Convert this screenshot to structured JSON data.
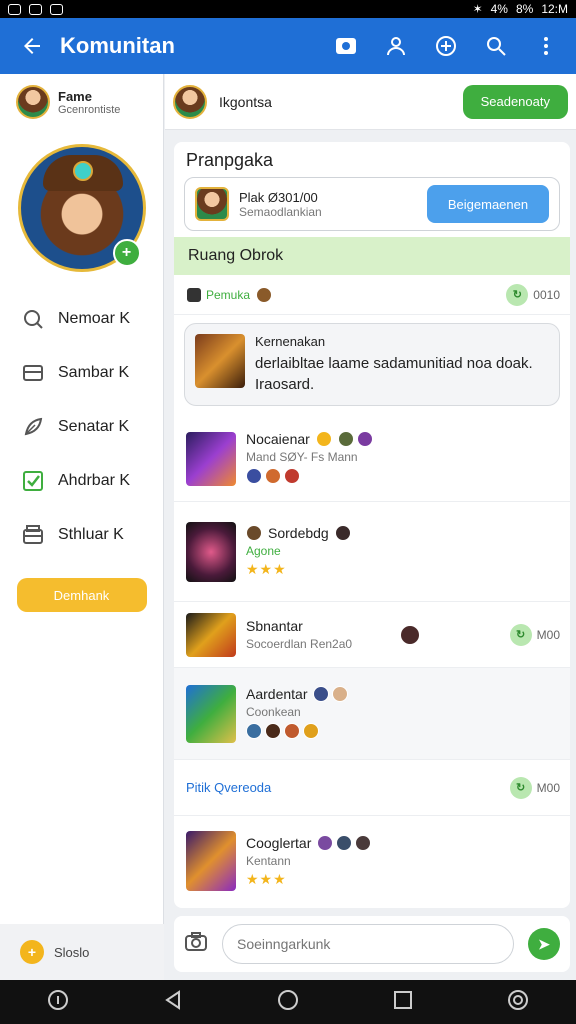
{
  "status_bar": {
    "battery": "8%",
    "time": "12:M",
    "signal": "4%",
    "left_icons": [
      "v-icon",
      "clock-icon",
      "cloud-icon"
    ]
  },
  "app_bar": {
    "title": "Komunitan",
    "color": "#1f6fd6",
    "actions": [
      "camera-icon",
      "person-icon",
      "add-icon",
      "search-icon",
      "more-icon"
    ]
  },
  "sidebar": {
    "profile_name": "Fame",
    "profile_sub": "Gcenrontiste",
    "menu": [
      {
        "label": "Nemoar K",
        "icon": "search-icon"
      },
      {
        "label": "Sambar K",
        "icon": "inbox-icon"
      },
      {
        "label": "Senatar K",
        "icon": "feather-icon"
      },
      {
        "label": "Ahdrbar K",
        "icon": "checkbox-icon"
      },
      {
        "label": "Sthluar K",
        "icon": "archive-icon"
      }
    ],
    "button_label": "Demhank",
    "footer_label": "Sloslo"
  },
  "topbar": {
    "name": "Ikgontsa",
    "button_label": "Seadenoaty"
  },
  "card": {
    "title": "Pranpgaka",
    "invite": {
      "line1": "Plak Ø301/00",
      "line2": "Semaodlankian",
      "button": "Beigemaenen"
    },
    "chat_header": "Ruang Obrok",
    "section_label": "Pemuka",
    "section_count": "0010",
    "bubble": {
      "title": "Kernenakan",
      "message": "derlaibltae laame sadamunitiad noa doak. Iraosard."
    },
    "rows": [
      {
        "title": "Nocaienar",
        "sub": "Mand SØY- Fs Mann",
        "kind": "badges"
      },
      {
        "title": "Sordebdg",
        "sub": "Agone",
        "kind": "stars3"
      },
      {
        "title": "Sbnantar",
        "sub": "Socoerdlan Ren2a0",
        "kind": "count",
        "count": "M00"
      },
      {
        "title": "Aardentar",
        "sub": "Coonkean",
        "kind": "badges"
      }
    ],
    "link": {
      "label": "Pitik Qvereoda",
      "count": "M00"
    },
    "last_row": {
      "title": "Cooglertar",
      "sub": "Kentann"
    }
  },
  "composer": {
    "placeholder": "Soeinngarkunk"
  }
}
